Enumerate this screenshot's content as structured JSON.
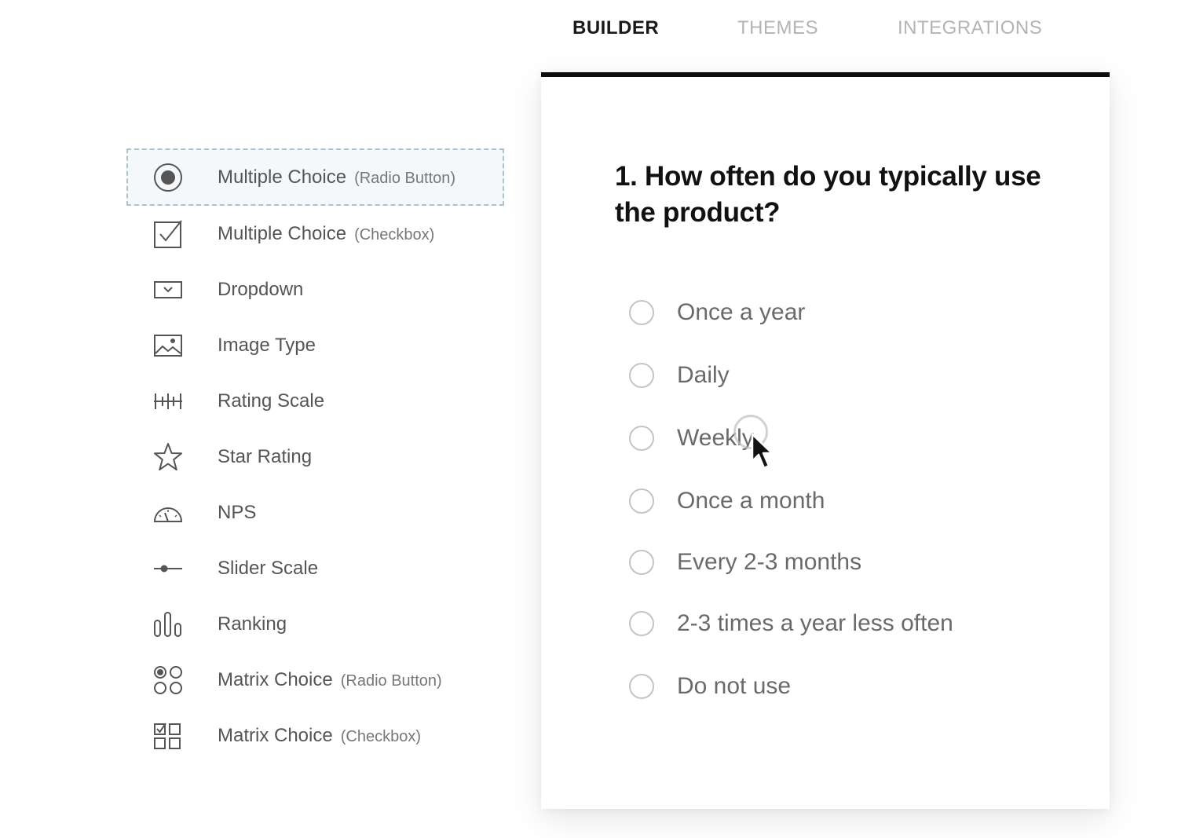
{
  "tabs": [
    {
      "label": "BUILDER",
      "active": true
    },
    {
      "label": "THEMES",
      "active": false
    },
    {
      "label": "INTEGRATIONS",
      "active": false
    }
  ],
  "sidebar": {
    "items": [
      {
        "label": "Multiple Choice",
        "sub": "(Radio Button)",
        "icon": "radio-button-icon",
        "selected": true
      },
      {
        "label": "Multiple Choice",
        "sub": "(Checkbox)",
        "icon": "checkbox-icon",
        "selected": false
      },
      {
        "label": "Dropdown",
        "sub": "",
        "icon": "dropdown-icon",
        "selected": false
      },
      {
        "label": "Image Type",
        "sub": "",
        "icon": "image-icon",
        "selected": false
      },
      {
        "label": "Rating Scale",
        "sub": "",
        "icon": "rating-scale-icon",
        "selected": false
      },
      {
        "label": "Star Rating",
        "sub": "",
        "icon": "star-icon",
        "selected": false
      },
      {
        "label": "NPS",
        "sub": "",
        "icon": "gauge-icon",
        "selected": false
      },
      {
        "label": "Slider Scale",
        "sub": "",
        "icon": "slider-icon",
        "selected": false
      },
      {
        "label": "Ranking",
        "sub": "",
        "icon": "ranking-icon",
        "selected": false
      },
      {
        "label": "Matrix Choice",
        "sub": "(Radio Button)",
        "icon": "matrix-radio-icon",
        "selected": false
      },
      {
        "label": "Matrix Choice",
        "sub": "(Checkbox)",
        "icon": "matrix-checkbox-icon",
        "selected": false
      }
    ]
  },
  "question": {
    "number": "1.",
    "text": "How often do you typically use the product?",
    "options": [
      "Once a year",
      "Daily",
      "Weekly",
      "Once a month",
      "Every 2-3 months",
      "2-3 times a year less often",
      "Do not use"
    ]
  },
  "colors": {
    "active_tab": "#1a1a1a",
    "inactive_tab": "#b4b4b4",
    "card_top_border": "#0d0d0d",
    "selected_border": "#a9c3cf",
    "option_text": "#6a6a6a",
    "radio_border": "#c4c4c4"
  }
}
